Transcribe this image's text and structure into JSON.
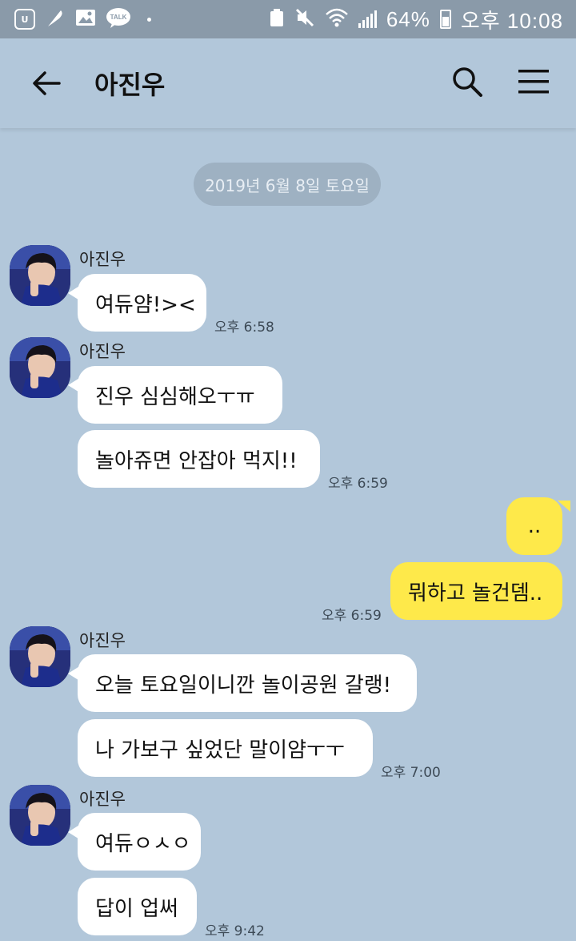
{
  "status_bar": {
    "battery": "64%",
    "time": "오후 10:08"
  },
  "header": {
    "title": "아진우"
  },
  "date_divider": "2019년 6월 8일 토요일",
  "messages": {
    "group1": {
      "sender": "아진우",
      "bubbles": [
        "여듀얌!><"
      ],
      "time": "오후 6:58"
    },
    "group2": {
      "sender": "아진우",
      "bubbles": [
        "진우 심심해오ㅜㅠ",
        "놀아쥬면 안잡아 먹지!!"
      ],
      "time": "오후 6:59"
    },
    "mine1": {
      "bubbles": [
        "..",
        "뭐하고 놀건뎀.."
      ],
      "time": "오후 6:59"
    },
    "group3": {
      "sender": "아진우",
      "bubbles": [
        "오늘 토요일이니깐 놀이공원 갈랭!",
        "나 가보구 싶었단 말이얌ㅜㅜ"
      ],
      "time": "오후 7:00"
    },
    "group4": {
      "sender": "아진우",
      "bubbles": [
        "여듀ㅇㅅㅇ",
        "답이 업써"
      ],
      "time": "오후 9:42"
    }
  },
  "colors": {
    "background": "#b2c7da",
    "status_bar": "#8a9aa9",
    "my_bubble": "#fee94a",
    "other_bubble": "#ffffff"
  }
}
